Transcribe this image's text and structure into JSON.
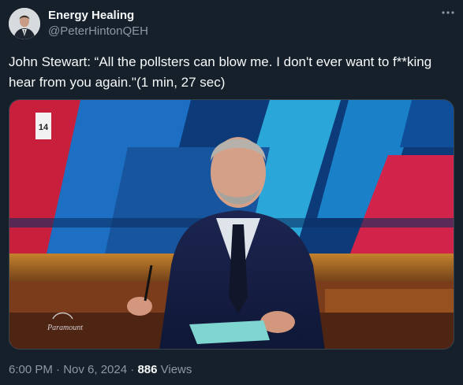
{
  "author": {
    "display_name": "Energy Healing",
    "handle": "@PeterHintonQEH"
  },
  "tweet": {
    "text": "John Stewart: “All the pollsters can blow me. I don't ever want to f**king hear from you again.\"(1 min, 27 sec)",
    "timestamp": "6:00 PM · Nov 6, 2024",
    "separator": "·",
    "views_count": "886",
    "views_label": "Views"
  },
  "media": {
    "channel_bug": "14",
    "network_logo_text": "Paramount"
  },
  "icons": {
    "more": "more-options-icon",
    "avatar": "avatar-image"
  },
  "colors": {
    "background": "#15202b",
    "text_primary": "#f7f9f9",
    "text_secondary": "#8b98a5",
    "border": "#38444d"
  }
}
